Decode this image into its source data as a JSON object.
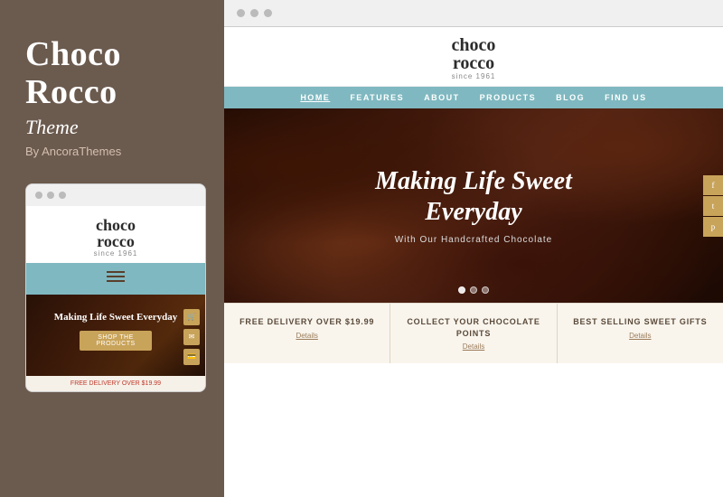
{
  "sidebar": {
    "title_line1": "Choco",
    "title_line2": "Rocco",
    "subtitle": "Theme",
    "by": "By AncoraThemes"
  },
  "mobile": {
    "logo_line1": "choco",
    "logo_line2": "rocco",
    "logo_since": "since 1961",
    "hero_title": "Making Life Sweet Everyday",
    "shop_btn": "SHOP THE PRODUCTS",
    "footer_text": "FREE DELIVERY OVER",
    "footer_price": "$19.99"
  },
  "browser": {
    "logo_line1": "choco",
    "logo_line2": "rocco",
    "logo_since": "since 1961",
    "nav_items": [
      "HOME",
      "FEATURES",
      "ABOUT",
      "PRODUCTS",
      "BLOG",
      "FIND US"
    ],
    "hero_title_line1": "Making Life Sweet",
    "hero_title_line2": "Everyday",
    "hero_sub": "With Our Handcrafted Chocolate",
    "features": [
      {
        "title": "FREE DELIVERY OVER $19.99",
        "details": "Details"
      },
      {
        "title": "COLLECT YOUR CHOCOLATE POINTS",
        "details": "Details"
      },
      {
        "title": "BEST SELLING SWEET GIFTS",
        "details": "Details"
      }
    ]
  },
  "colors": {
    "accent": "#c8a35a",
    "nav_bg": "#7fb8c0",
    "sidebar_bg": "#6b5a4e"
  }
}
